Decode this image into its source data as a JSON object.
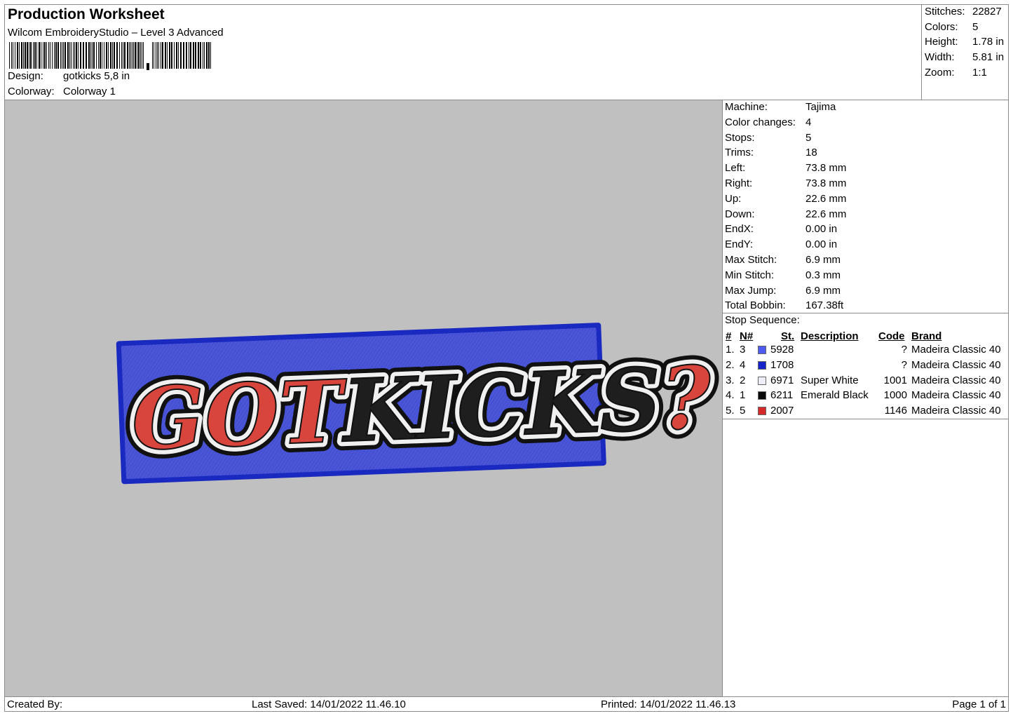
{
  "header": {
    "title": "Production Worksheet",
    "software": "Wilcom EmbroideryStudio – Level 3 Advanced",
    "design_label": "Design:",
    "design_value": "gotkicks 5,8 in",
    "colorway_label": "Colorway:",
    "colorway_value": "Colorway 1"
  },
  "summary": [
    {
      "label": "Stitches:",
      "value": "22827"
    },
    {
      "label": "Colors:",
      "value": "5"
    },
    {
      "label": "Height:",
      "value": "1.78 in"
    },
    {
      "label": "Width:",
      "value": "5.81 in"
    },
    {
      "label": "Zoom:",
      "value": "1:1"
    }
  ],
  "details": [
    {
      "label": "Machine:",
      "value": "Tajima"
    },
    {
      "label": "Color changes:",
      "value": "4"
    },
    {
      "label": "Stops:",
      "value": "5"
    },
    {
      "label": "Trims:",
      "value": "18"
    },
    {
      "label": "Left:",
      "value": "73.8 mm"
    },
    {
      "label": "Right:",
      "value": "73.8 mm"
    },
    {
      "label": "Up:",
      "value": "22.6 mm"
    },
    {
      "label": "Down:",
      "value": "22.6 mm"
    },
    {
      "label": "EndX:",
      "value": "0.00 in"
    },
    {
      "label": "EndY:",
      "value": "0.00 in"
    },
    {
      "label": "Max Stitch:",
      "value": "6.9 mm"
    },
    {
      "label": "Min Stitch:",
      "value": "0.3 mm"
    },
    {
      "label": "Max Jump:",
      "value": "6.9 mm"
    },
    {
      "label": "Total Bobbin:",
      "value": "167.38ft"
    }
  ],
  "stop_sequence": {
    "title": "Stop Sequence:",
    "columns": {
      "idx": "#",
      "n": "N#",
      "st": "St.",
      "desc": "Description",
      "code": "Code",
      "brand": "Brand"
    },
    "rows": [
      {
        "idx": "1.",
        "n": "3",
        "color": "#4f5bf0",
        "st": "5928",
        "desc": "",
        "code": "?",
        "brand": "Madeira Classic 40"
      },
      {
        "idx": "2.",
        "n": "4",
        "color": "#1424c8",
        "st": "1708",
        "desc": "",
        "code": "?",
        "brand": "Madeira Classic 40"
      },
      {
        "idx": "3.",
        "n": "2",
        "color": "#eeeef8",
        "st": "6971",
        "desc": "Super White",
        "code": "1001",
        "brand": "Madeira Classic 40"
      },
      {
        "idx": "4.",
        "n": "1",
        "color": "#0a0a0a",
        "st": "6211",
        "desc": "Emerald Black",
        "code": "1000",
        "brand": "Madeira Classic 40"
      },
      {
        "idx": "5.",
        "n": "5",
        "color": "#d62a2a",
        "st": "2007",
        "desc": "",
        "code": "1146",
        "brand": "Madeira Classic 40"
      }
    ]
  },
  "design_preview": {
    "text_red": "GOT",
    "text_black": "KICKS",
    "text_mark": "?",
    "patch_color": "#4a55d8",
    "border_color": "#1a2ac0",
    "background": "#c0c0c0"
  },
  "footer": {
    "created_by": "Created By:",
    "last_saved": "Last Saved: 14/01/2022 11.46.10",
    "printed": "Printed: 14/01/2022 11.46.13",
    "page": "Page 1 of 1"
  }
}
